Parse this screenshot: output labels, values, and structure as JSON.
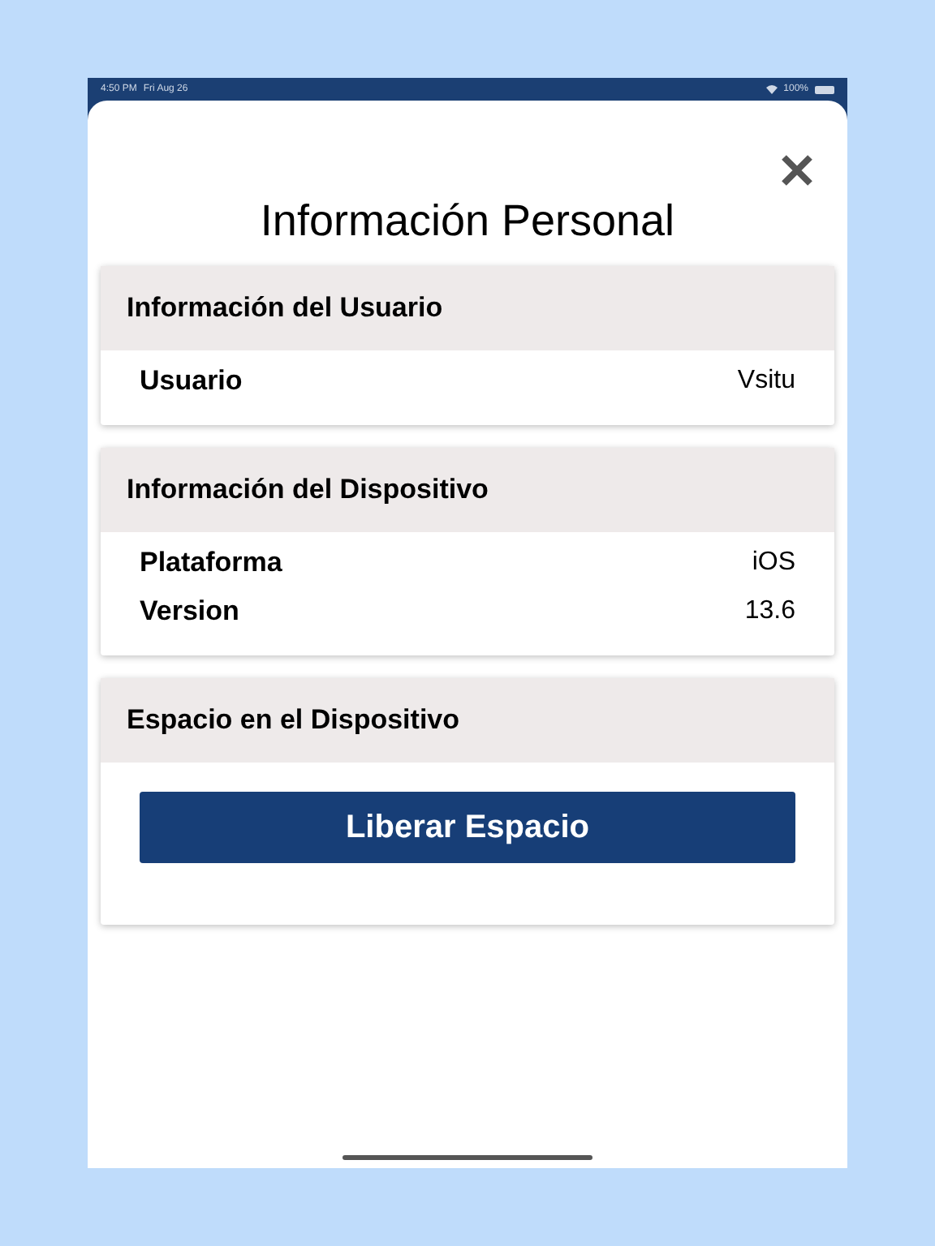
{
  "status_bar": {
    "time": "4:50 PM",
    "date": "Fri Aug 26",
    "battery": "100%"
  },
  "title": "Información Personal",
  "sections": [
    {
      "header": "Información del Usuario",
      "kind": "rows",
      "rows": [
        {
          "label": "Usuario",
          "value": "Vsitu"
        }
      ]
    },
    {
      "header": "Información del Dispositivo",
      "kind": "rows",
      "rows": [
        {
          "label": "Plataforma",
          "value": "iOS"
        },
        {
          "label": "Version",
          "value": "13.6"
        }
      ]
    },
    {
      "header": "Espacio en el Dispositivo",
      "kind": "button",
      "button": "Liberar Espacio"
    }
  ]
}
